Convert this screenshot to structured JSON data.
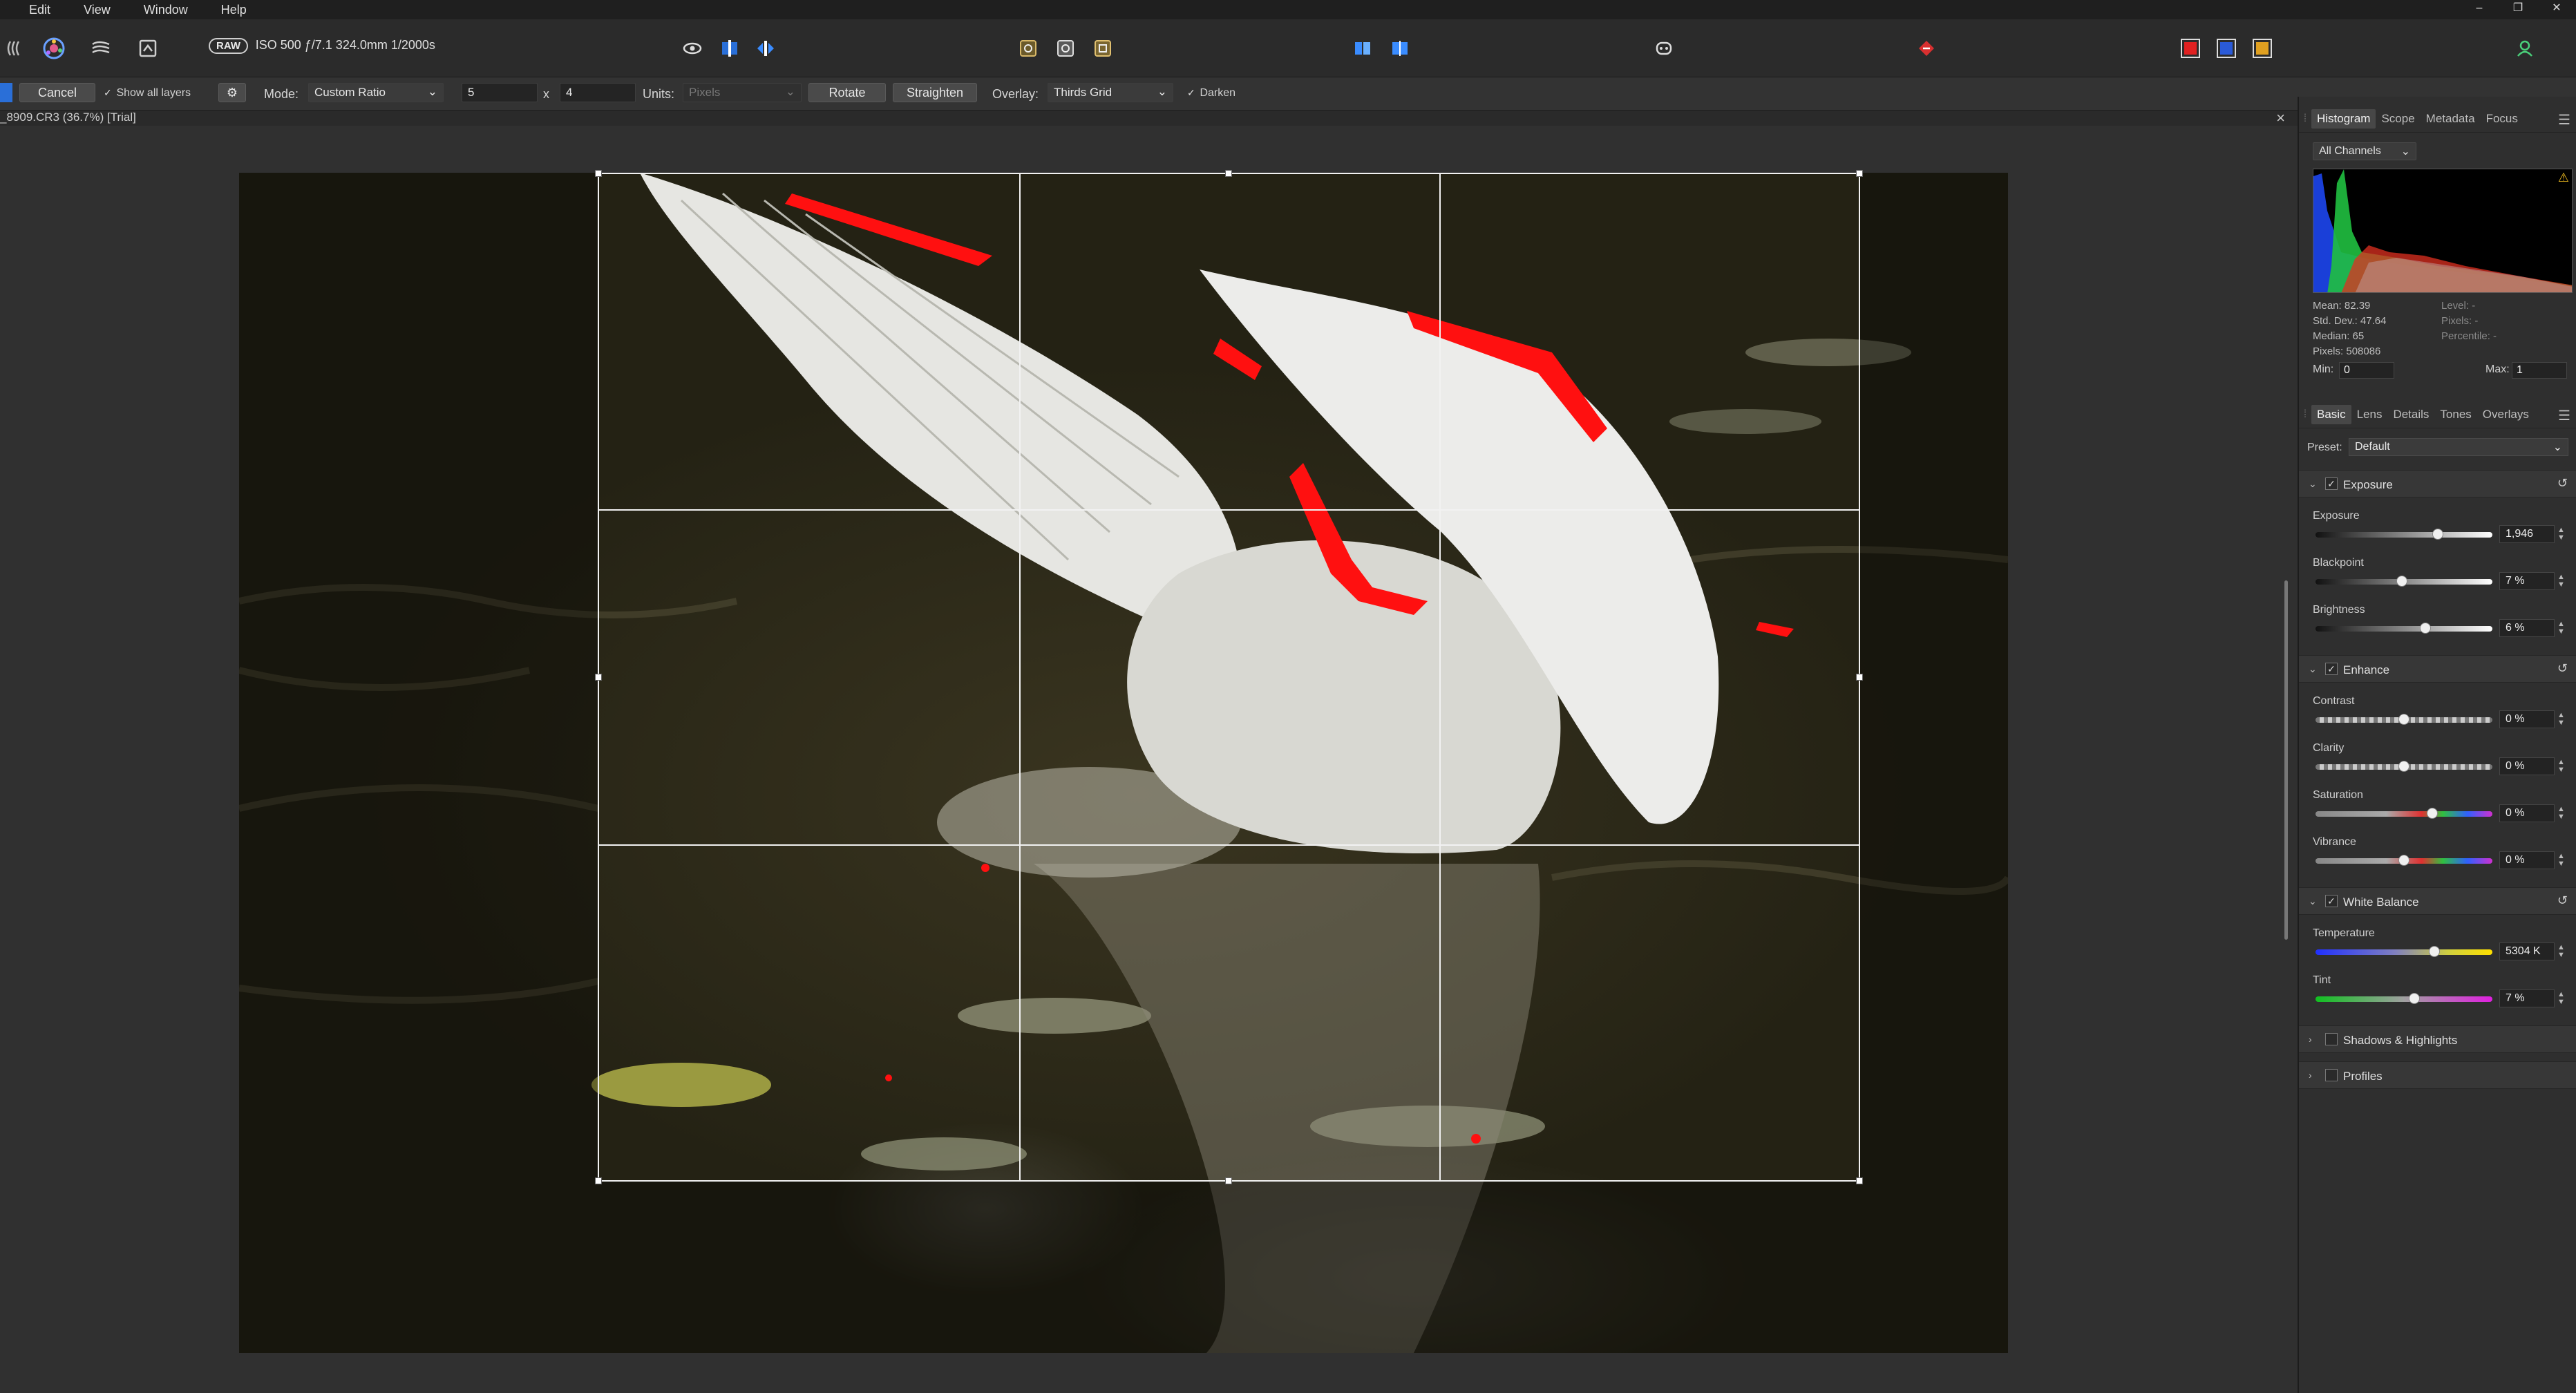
{
  "menu": [
    "Edit",
    "View",
    "Window",
    "Help"
  ],
  "toolbar": {
    "raw_badge": "RAW",
    "exif": "ISO 500 ƒ/7.1 324.0mm 1/2000s"
  },
  "context": {
    "cancel": "Cancel",
    "show_all_layers": "Show all layers",
    "mode_label": "Mode:",
    "mode_value": "Custom Ratio",
    "ratio_w": "5",
    "ratio_x": "x",
    "ratio_h": "4",
    "units_label": "Units:",
    "units_value": "Pixels",
    "rotate": "Rotate",
    "straighten": "Straighten",
    "overlay_label": "Overlay:",
    "overlay_value": "Thirds Grid",
    "darken": "Darken"
  },
  "document": {
    "title": "_8909.CR3 (36.7%) [Trial]",
    "close": "×"
  },
  "histogram_panel": {
    "tabs": [
      "Histogram",
      "Scope",
      "Metadata",
      "Focus"
    ],
    "channel": "All Channels",
    "stats": [
      "Mean: 82.39",
      "Std. Dev.: 47.64",
      "Median: 65",
      "Pixels: 508086"
    ],
    "stats2": [
      "Level: -",
      "Pixels: -",
      "Percentile: -"
    ],
    "min_label": "Min:",
    "min_value": "0",
    "max_label": "Max:",
    "max_value": "1"
  },
  "develop_panel": {
    "tabs": [
      "Basic",
      "Lens",
      "Details",
      "Tones",
      "Overlays"
    ],
    "preset_label": "Preset:",
    "preset_value": "Default",
    "sections": {
      "exposure": "Exposure",
      "enhance": "Enhance",
      "white_balance": "White Balance",
      "shadows": "Shadows & Highlights",
      "profiles": "Profiles"
    },
    "sliders": {
      "exposure": {
        "label": "Exposure",
        "value": "1,946",
        "level": 0.69
      },
      "blackpoint": {
        "label": "Blackpoint",
        "value": "7 %",
        "level": 0.49
      },
      "brightness": {
        "label": "Brightness",
        "value": "6 %",
        "level": 0.62
      },
      "contrast": {
        "label": "Contrast",
        "value": "0 %",
        "level": 0.5
      },
      "clarity": {
        "label": "Clarity",
        "value": "0 %",
        "level": 0.5
      },
      "saturation": {
        "label": "Saturation",
        "value": "0 %",
        "level": 0.66
      },
      "vibrance": {
        "label": "Vibrance",
        "value": "0 %",
        "level": 0.5
      },
      "temperature": {
        "label": "Temperature",
        "value": "5304 K",
        "level": 0.67
      },
      "tint": {
        "label": "Tint",
        "value": "7 %",
        "level": 0.56
      }
    }
  },
  "colors": {
    "clipping": "#ff1010",
    "accent": "#4aa3ff"
  }
}
